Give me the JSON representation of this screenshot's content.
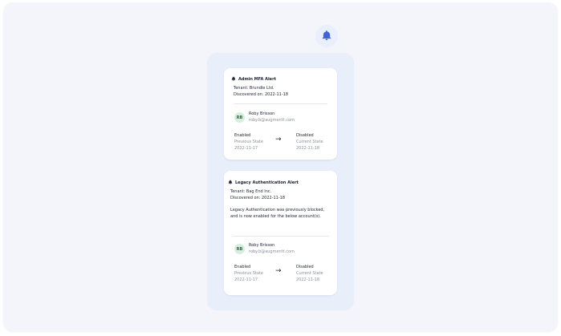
{
  "card1": {
    "title": "Admin MFA Alert",
    "tenant": "Tenant: Brundle Ltd.",
    "discovered": "Discovered on: 2022-11-18",
    "user": {
      "initials": "RB",
      "name": "Roby Brisson",
      "email": "roby.b@augmentt.com"
    },
    "prev": {
      "value": "Enabled",
      "label": "Previous State",
      "date": "2022-11-17"
    },
    "curr": {
      "value": "Disabled",
      "label": "Current State",
      "date": "2022-11-18"
    }
  },
  "card2": {
    "title": "Legacy Authentication Alert",
    "tenant": "Tenant: Bag End Inc.",
    "discovered": "Discovered on: 2022-11-18",
    "description": "Legacy Authentication was previously blocked, and is now enabled for the below account(s).",
    "user": {
      "initials": "RB",
      "name": "Roby Brisson",
      "email": "roby.b@augmentt.com"
    },
    "prev": {
      "value": "Enabled",
      "label": "Previous State",
      "date": "2022-11-17"
    },
    "curr": {
      "value": "Disabled",
      "label": "Current State",
      "date": "2022-11-18"
    }
  },
  "icons": {
    "notification": "bell-icon",
    "arrow": "arrow-right-icon"
  },
  "colors": {
    "accent": "#3f63d7",
    "avatar_bg": "#d6eedd",
    "panel_bg": "#e9eefb"
  }
}
